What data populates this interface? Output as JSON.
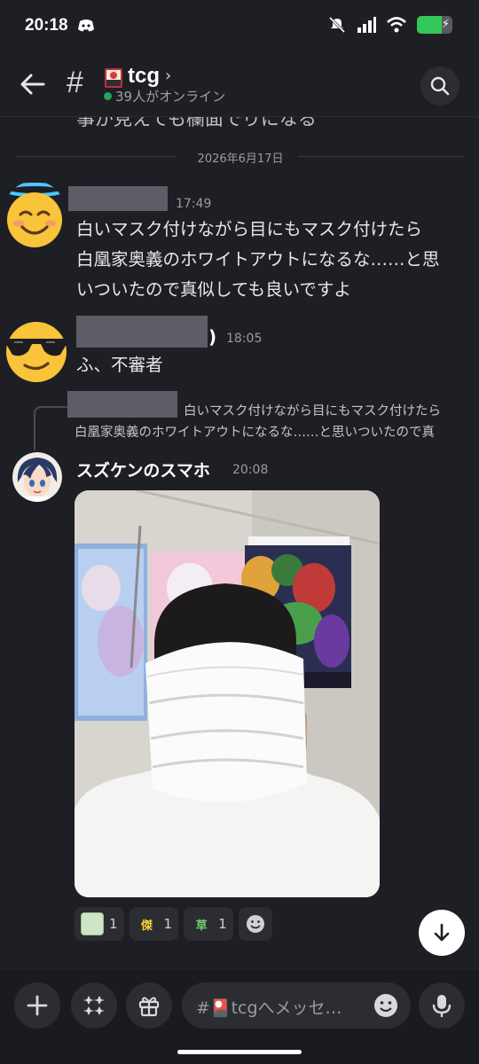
{
  "status": {
    "time": "20:18",
    "battery_level": 0.7
  },
  "header": {
    "channel_name": "tcg",
    "online": "39人がオンライン"
  },
  "cutoff_text": "事が見えても欄面でりになる",
  "date_divider": "2026年6月17日",
  "messages": [
    {
      "time": "17:49",
      "text_lines": [
        "白いマスク付けながら目にもマスク付けたら",
        "白凰家奥義のホワイトアウトになるな……と思",
        "いついたので真似しても良いですよ"
      ]
    },
    {
      "time": "18:05",
      "name_suffix": ")",
      "text": "ふ、不審者"
    },
    {
      "reply_lines": [
        "白いマスク付けながら目にもマスク付けたら",
        "白凰家奥義のホワイトアウトになるな……と思いついたので真"
      ],
      "author": "スズケンのスマホ",
      "time": "20:08"
    }
  ],
  "reactions": [
    {
      "emoji_label": "",
      "count": "1",
      "color": "#cfe5c6"
    },
    {
      "emoji_label": "傑",
      "count": "1",
      "color": "#f5d23a"
    },
    {
      "emoji_label": "草",
      "count": "1",
      "color": "#6fd16b"
    }
  ],
  "composer": {
    "placeholder": "#🎴tcgへメッセ…"
  }
}
